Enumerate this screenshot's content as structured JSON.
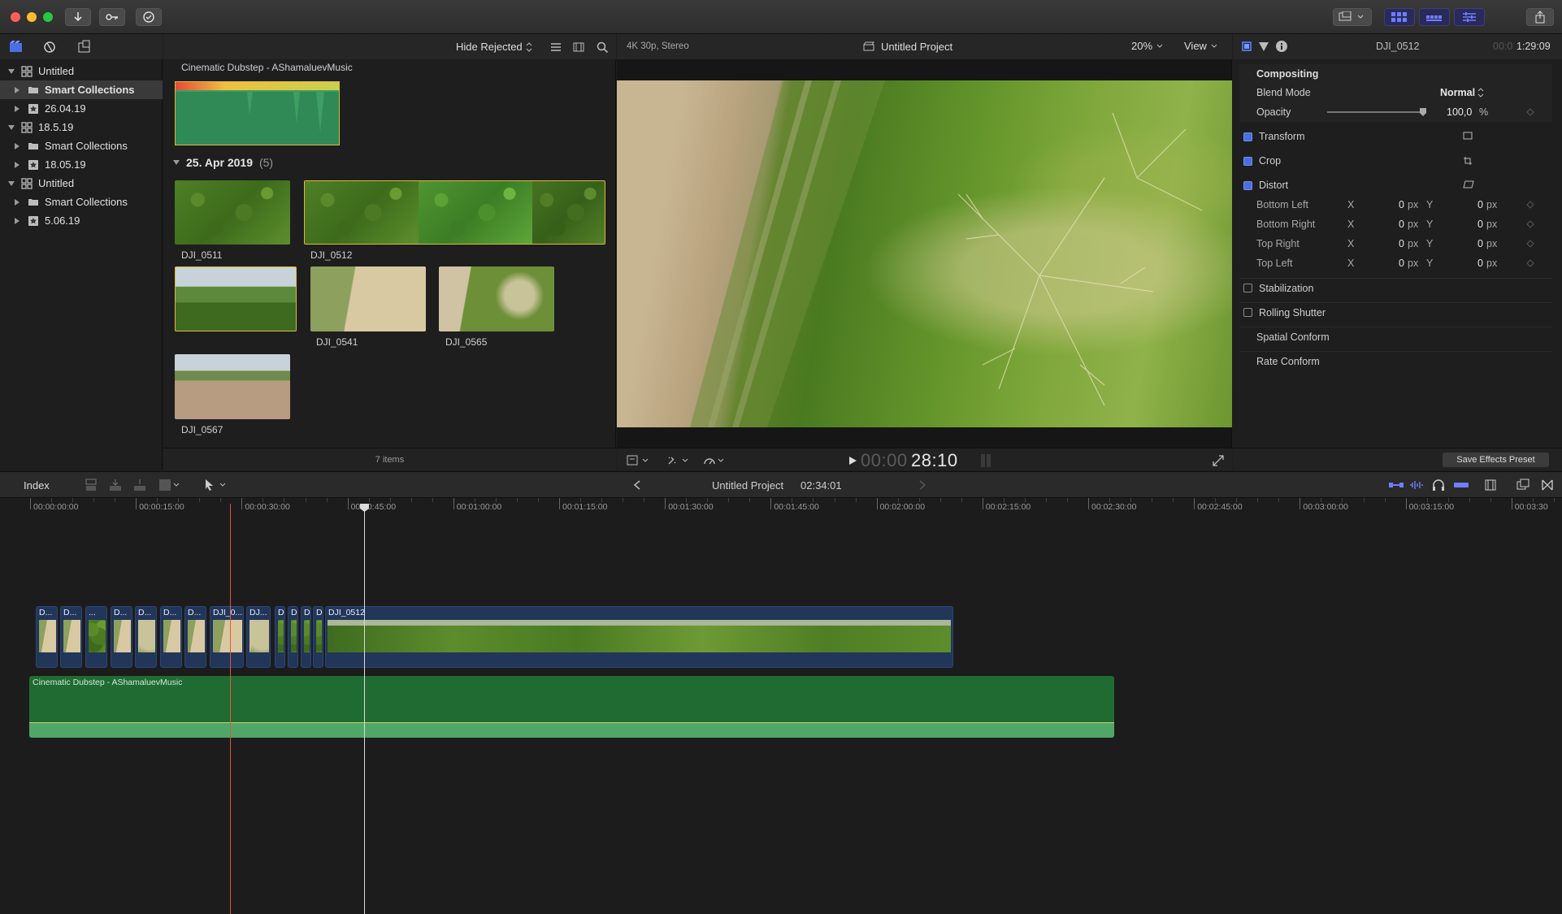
{
  "titlebar": {
    "icons": [
      "import-icon",
      "keywords-icon",
      "background-tasks-icon",
      "display-icon",
      "browser-layout-icon",
      "timeline-layout-icon",
      "inspector-layout-icon",
      "share-icon"
    ]
  },
  "library": {
    "items": [
      {
        "label": "Untitled",
        "level": 0,
        "type": "library",
        "expanded": true
      },
      {
        "label": "Smart Collections",
        "level": 1,
        "type": "folder",
        "selected": true
      },
      {
        "label": "26.04.19",
        "level": 1,
        "type": "event"
      },
      {
        "label": "18.5.19",
        "level": 0,
        "type": "library",
        "expanded": true
      },
      {
        "label": "Smart Collections",
        "level": 1,
        "type": "folder"
      },
      {
        "label": "18.05.19",
        "level": 1,
        "type": "event"
      },
      {
        "label": "Untitled",
        "level": 0,
        "type": "library",
        "expanded": true
      },
      {
        "label": "Smart Collections",
        "level": 1,
        "type": "folder"
      },
      {
        "label": "5.06.19",
        "level": 1,
        "type": "event"
      }
    ]
  },
  "browser": {
    "filter": "Hide Rejected",
    "audio_clip_title": "Cinematic Dubstep - AShamaluevMusic",
    "group_title": "25. Apr 2019",
    "group_count": "(5)",
    "clips": [
      "DJI_0511",
      "DJI_0512",
      "DJI_0541",
      "DJI_0565",
      "DJI_0567"
    ],
    "item_count": "7 items"
  },
  "viewer": {
    "format": "4K 30p, Stereo",
    "project_title": "Untitled Project",
    "zoom": "20%",
    "view_menu": "View",
    "timecode_dim": "00:00",
    "timecode": "28:10"
  },
  "inspector": {
    "clip_name": "DJI_0512",
    "duration_dim": "00:0",
    "duration": "1:29:09",
    "compositing": "Compositing",
    "blend_mode_label": "Blend Mode",
    "blend_mode_value": "Normal",
    "opacity_label": "Opacity",
    "opacity_value": "100,0",
    "opacity_unit": "%",
    "opacity_level": 1.0,
    "transform": "Transform",
    "crop": "Crop",
    "distort": "Distort",
    "distort_rows": [
      {
        "label": "Bottom Left",
        "x": "0",
        "y": "0"
      },
      {
        "label": "Bottom Right",
        "x": "0",
        "y": "0"
      },
      {
        "label": "Top Right",
        "x": "0",
        "y": "0"
      },
      {
        "label": "Top Left",
        "x": "0",
        "y": "0"
      }
    ],
    "axis_x": "X",
    "axis_y": "Y",
    "unit_px": "px",
    "stabilization": "Stabilization",
    "rolling_shutter": "Rolling Shutter",
    "spatial_conform": "Spatial Conform",
    "rate_conform": "Rate Conform",
    "save_preset": "Save Effects Preset"
  },
  "timeline": {
    "index_label": "Index",
    "project_title": "Untitled Project",
    "project_duration": "02:34:01",
    "ruler_labels": [
      "00:00:00:00",
      "00:00:15:00",
      "00:00:30:00",
      "00:00:45:00",
      "00:01:00:00",
      "00:01:15:00",
      "00:01:30:00",
      "00:01:45:00",
      "00:02:00:00",
      "00:02:15:00",
      "00:02:30:00",
      "00:02:45:00",
      "00:03:00:00",
      "00:03:15:00",
      "00:03:30"
    ],
    "short_clips": [
      "D...",
      "D...",
      "...",
      "D...",
      "D...",
      "D...",
      "D...",
      "DJI_0...",
      "DJ...",
      "D",
      "D",
      "D",
      "D"
    ],
    "main_clip": "DJI_0512",
    "audio_clip": "Cinematic Dubstep - AShamaluevMusic"
  },
  "colors": {
    "accent": "#4b6fe2",
    "video_clip": "#22365a",
    "audio_clip": "#1f6b32",
    "playhead": "#ffffff",
    "skimmer": "#e0573a"
  }
}
